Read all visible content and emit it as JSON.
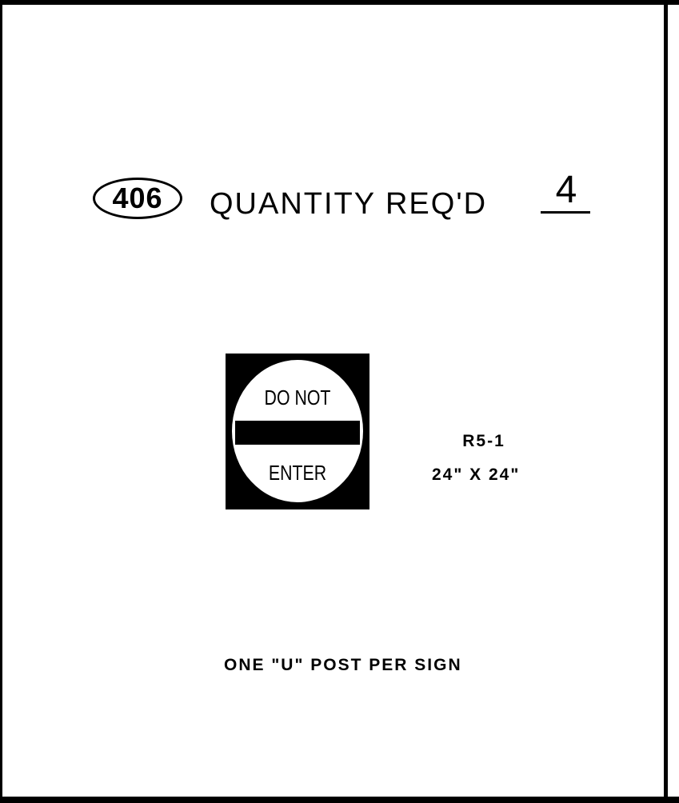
{
  "item": {
    "number": "406"
  },
  "quantity": {
    "label": "QUANTITY REQ'D",
    "value": "4"
  },
  "sign": {
    "top_text": "DO NOT",
    "bottom_text": "ENTER",
    "code": "R5-1",
    "size": "24\" X 24\""
  },
  "note": "ONE \"U\" POST PER SIGN",
  "colors": {
    "ink": "#000000",
    "paper": "#ffffff"
  }
}
